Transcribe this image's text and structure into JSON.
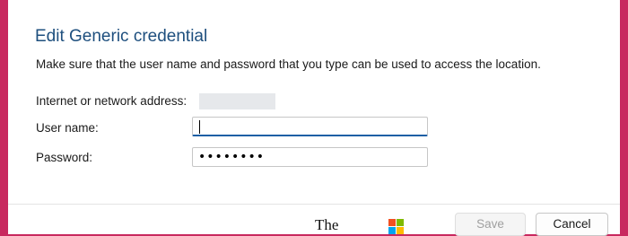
{
  "dialog": {
    "title": "Edit Generic credential",
    "description": "Make sure that the user name and password that you type can be used to access the location."
  },
  "fields": {
    "address_label": "Internet or network address:",
    "username_label": "User name:",
    "username_value": "",
    "password_label": "Password:",
    "password_mask": "••••••••"
  },
  "footer": {
    "brand_text": "The",
    "save_label": "Save",
    "cancel_label": "Cancel"
  },
  "colors": {
    "frame": "#c8295f",
    "title": "#1e4f7e",
    "focus_underline": "#1e5fa5"
  },
  "icons": [
    "windows-logo-icon"
  ]
}
